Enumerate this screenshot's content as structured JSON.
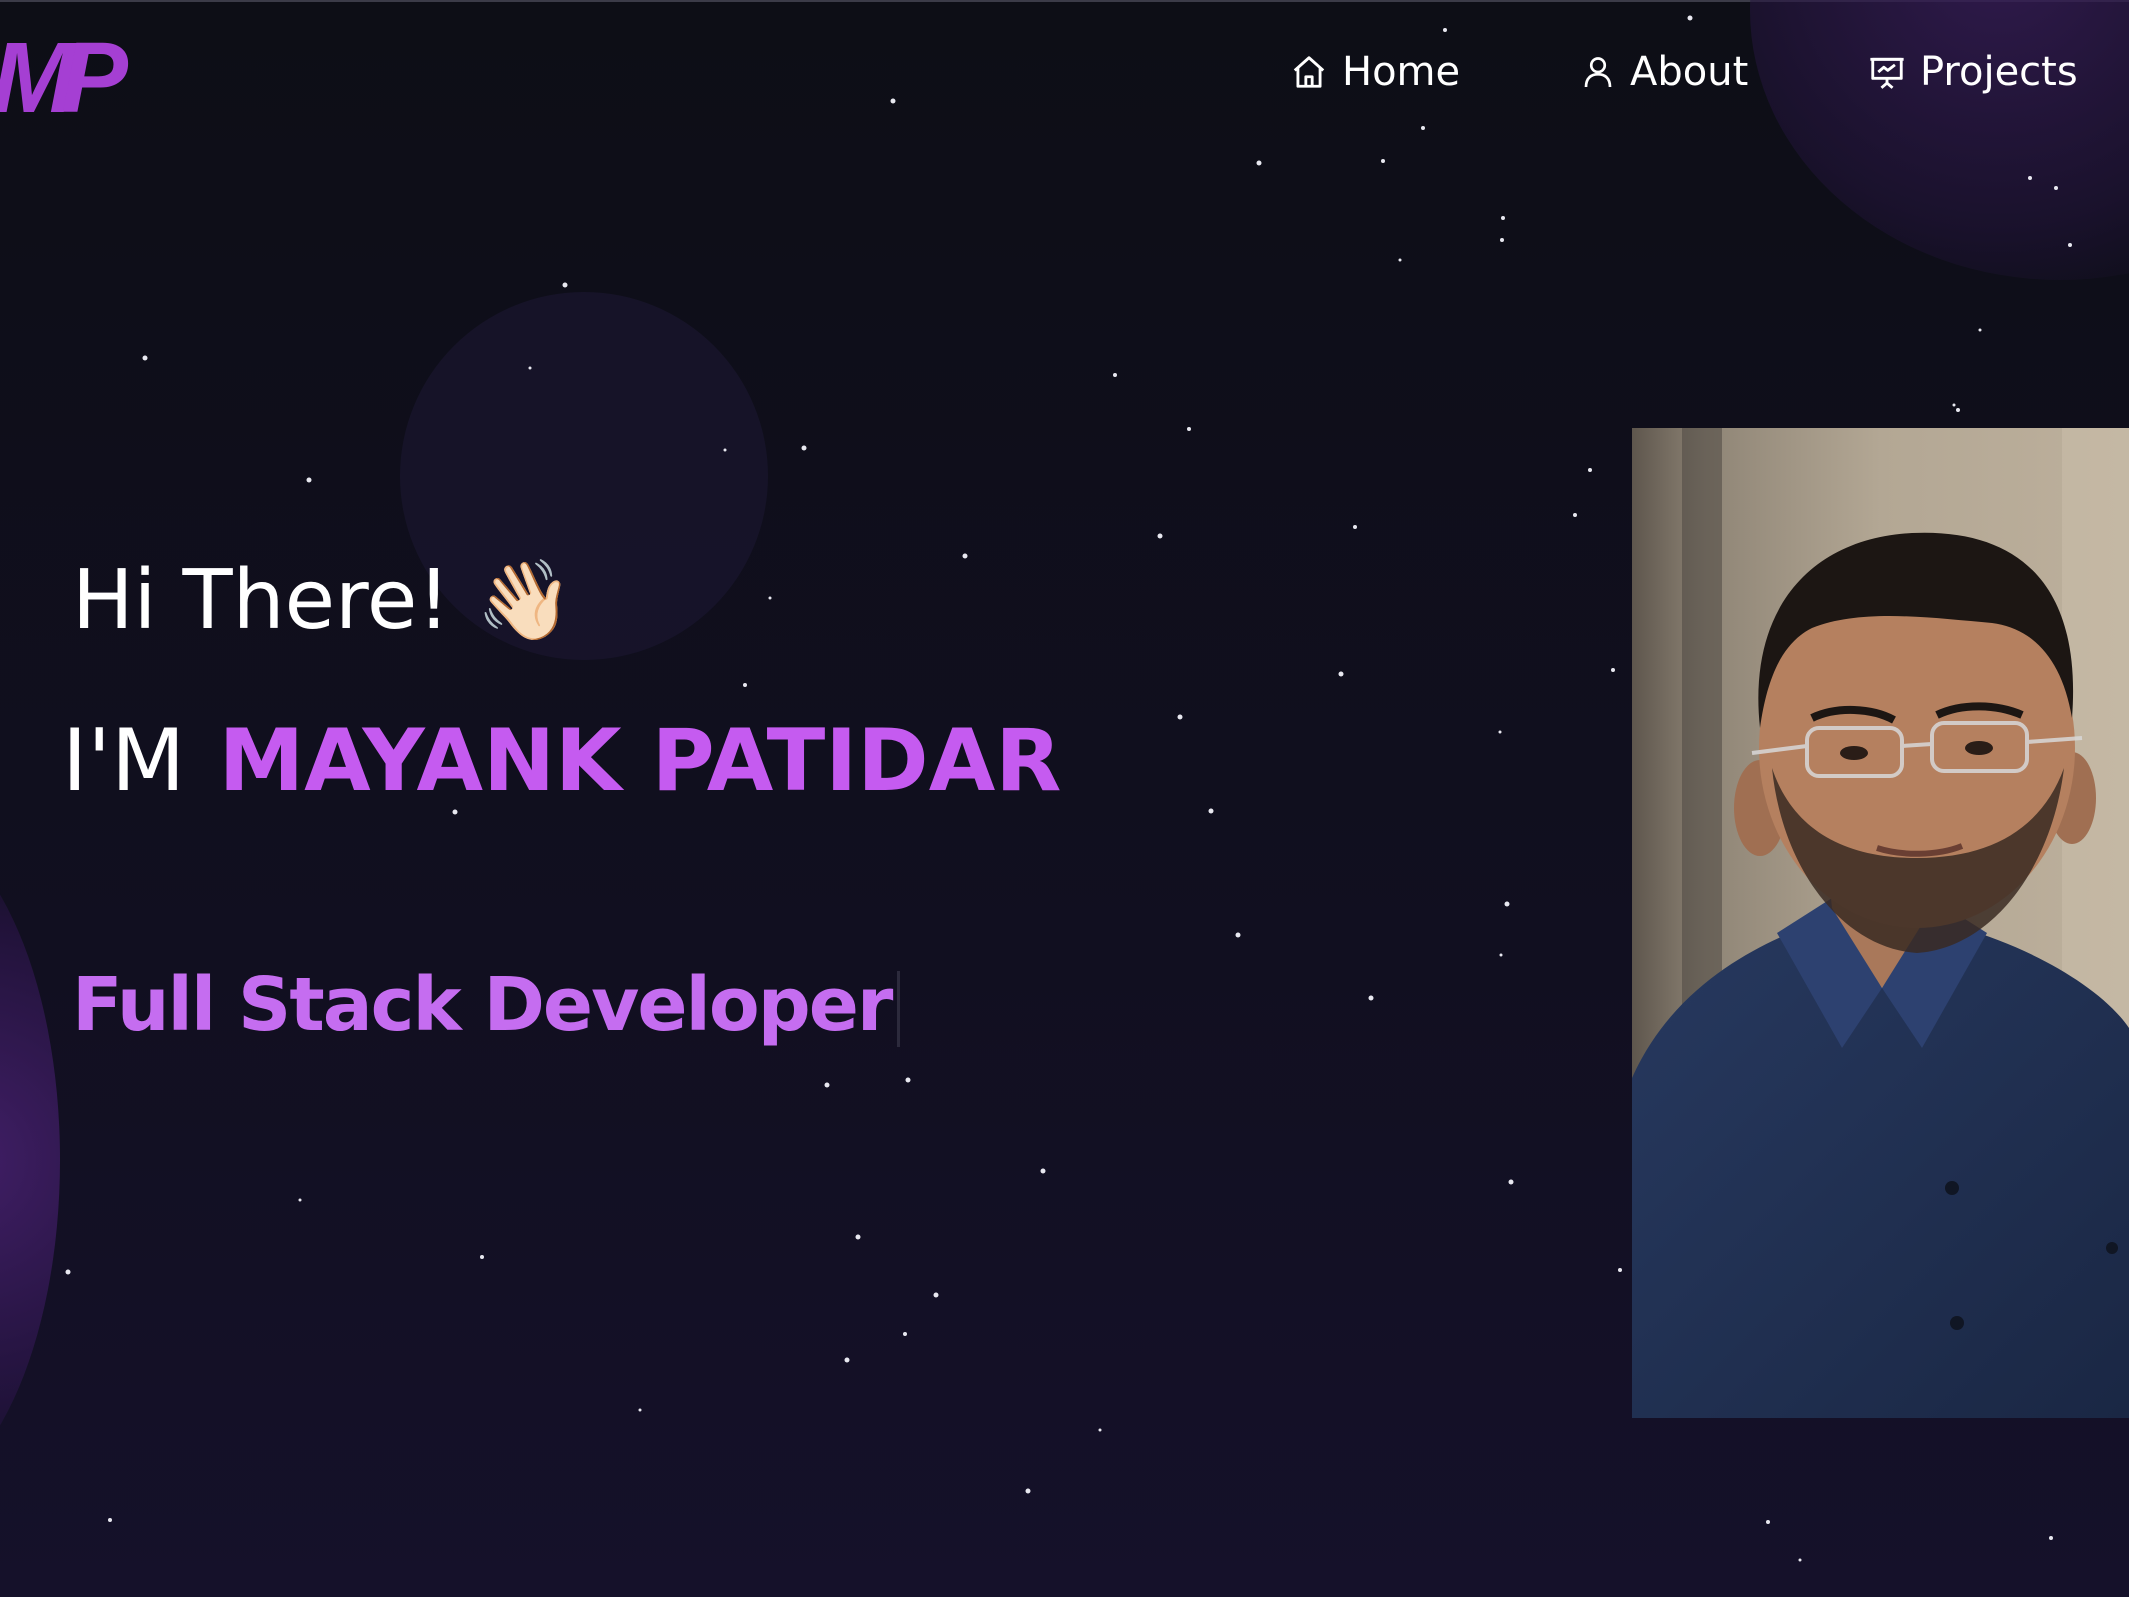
{
  "nav": {
    "logo_text": "MP",
    "items": [
      {
        "label": "Home",
        "icon": "home-icon"
      },
      {
        "label": "About",
        "icon": "user-icon"
      },
      {
        "label": "Projects",
        "icon": "presentation-chart-icon"
      }
    ]
  },
  "hero": {
    "greeting": "Hi There!",
    "wave_emoji": "👋🏻",
    "intro_prefix": "I'M",
    "name": "MAYANK PATIDAR",
    "role": "Full Stack Developer"
  },
  "colors": {
    "background": "#0d0e16",
    "accent": "#c55bf0",
    "text": "#ffffff"
  }
}
